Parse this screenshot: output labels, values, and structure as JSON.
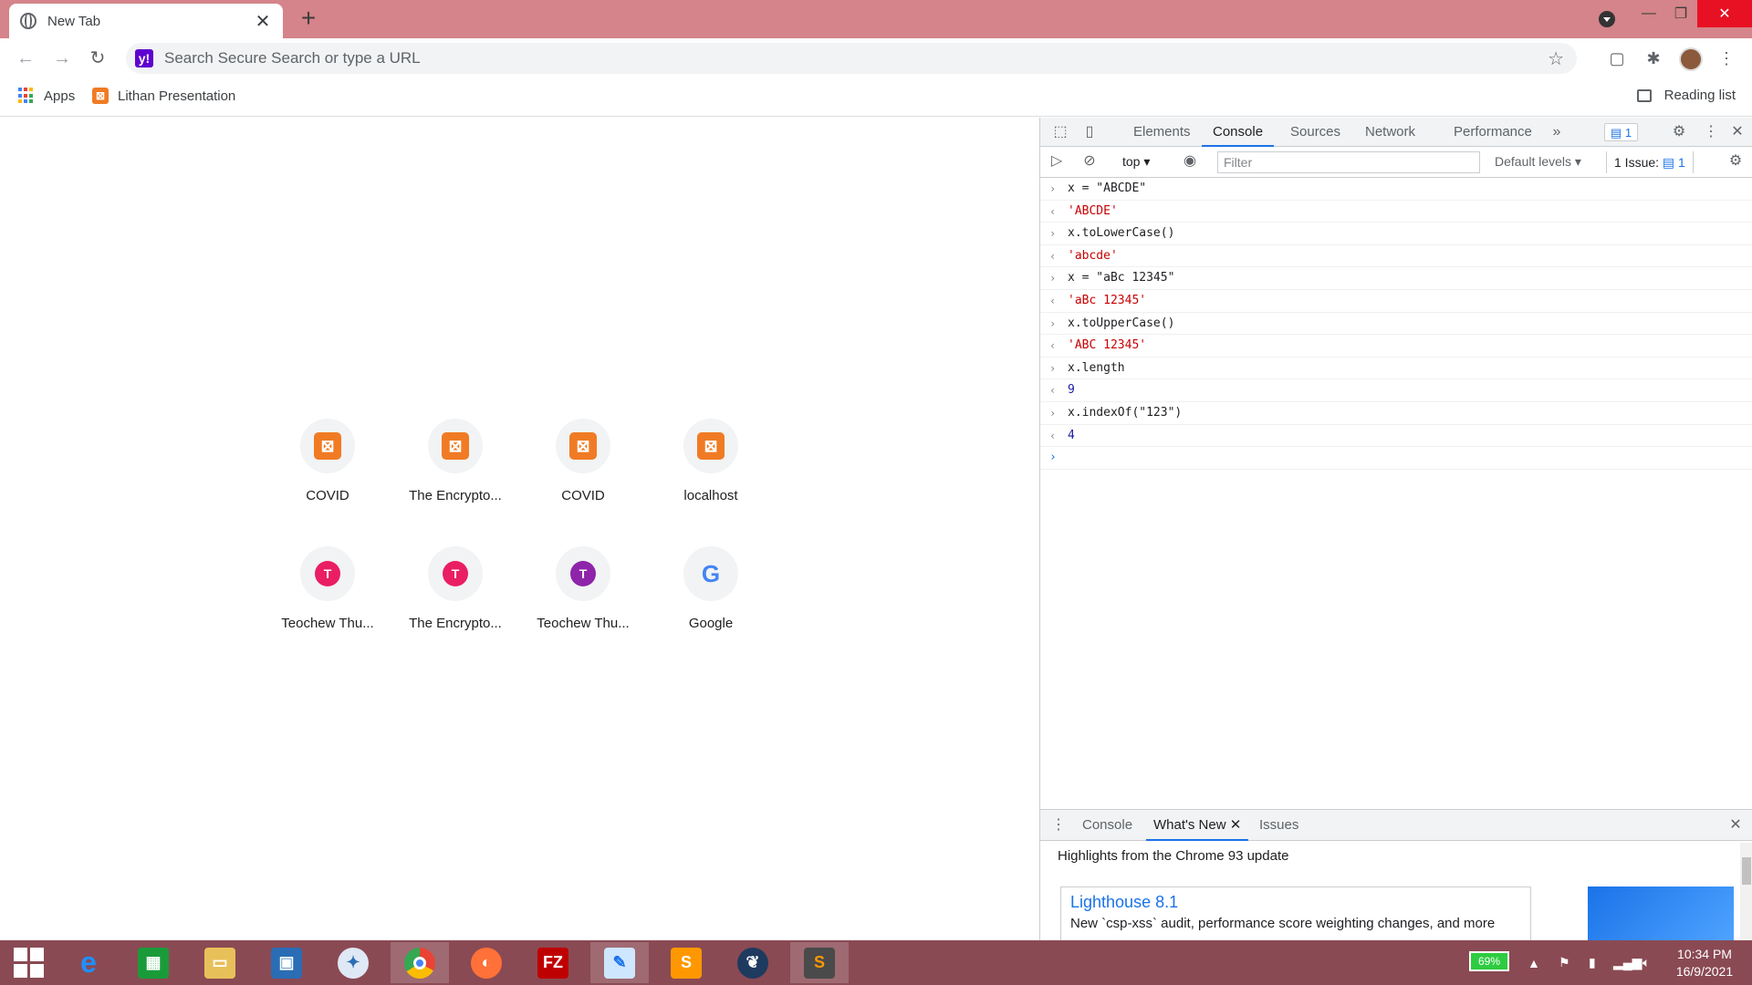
{
  "browser": {
    "tab_title": "New Tab",
    "tab_close": "✕",
    "new_tab": "+",
    "omnibox_placeholder": "Search Secure Search or type a URL",
    "omnibox_logo": "y!",
    "tab_bar_color": "#d4848a"
  },
  "bookmarks": {
    "apps_label": "Apps",
    "lithan_label": "Lithan Presentation",
    "reading_list_label": "Reading list"
  },
  "ntp": {
    "tiles": [
      {
        "label": "COVID",
        "icon": "xampp-icon"
      },
      {
        "label": "The Encrypto...",
        "icon": "xampp-icon"
      },
      {
        "label": "COVID",
        "icon": "xampp-icon"
      },
      {
        "label": "localhost",
        "icon": "xampp-icon"
      },
      {
        "label": "Teochew Thu...",
        "icon": "letter-icon",
        "letter": "T",
        "color": "#e91e63"
      },
      {
        "label": "The Encrypto...",
        "icon": "letter-icon",
        "letter": "T",
        "color": "#e91e63"
      },
      {
        "label": "Teochew Thu...",
        "icon": "letter-icon",
        "letter": "T",
        "color": "#8e24aa"
      },
      {
        "label": "Google",
        "icon": "google-icon",
        "letter": "G"
      }
    ]
  },
  "devtools": {
    "tabs": [
      "Elements",
      "Console",
      "Sources",
      "Network",
      "Performance"
    ],
    "active_tab": "Console",
    "more_tabs": "»",
    "issue_badge": "1",
    "context": "top",
    "filter_placeholder": "Filter",
    "levels": "Default levels",
    "issues_button": "1 Issue:",
    "issues_count": "1",
    "console_lines": [
      {
        "type": "input",
        "text": "x = \"ABCDE\""
      },
      {
        "type": "output",
        "text": "'ABCDE'"
      },
      {
        "type": "input",
        "text": "x.toLowerCase()"
      },
      {
        "type": "output",
        "text": "'abcde'"
      },
      {
        "type": "input",
        "text": "x = \"aBc 12345\""
      },
      {
        "type": "output",
        "text": "'aBc 12345'"
      },
      {
        "type": "input",
        "text": "x.toUpperCase()"
      },
      {
        "type": "output",
        "text": "'ABC 12345'"
      },
      {
        "type": "input",
        "text": "x.length"
      },
      {
        "type": "output-num",
        "text": "9"
      },
      {
        "type": "input",
        "text": "x.indexOf(\"123\")"
      },
      {
        "type": "output-num",
        "text": "4"
      }
    ],
    "drawer": {
      "tabs": [
        "Console",
        "What's New",
        "Issues"
      ],
      "active_tab": "What's New",
      "highlights": "Highlights from the Chrome 93 update",
      "card_title": "Lighthouse 8.1",
      "card_desc": "New `csp-xss` audit, performance score weighting changes, and more"
    }
  },
  "taskbar": {
    "battery": "69%",
    "time": "10:34 PM",
    "date": "16/9/2021"
  }
}
